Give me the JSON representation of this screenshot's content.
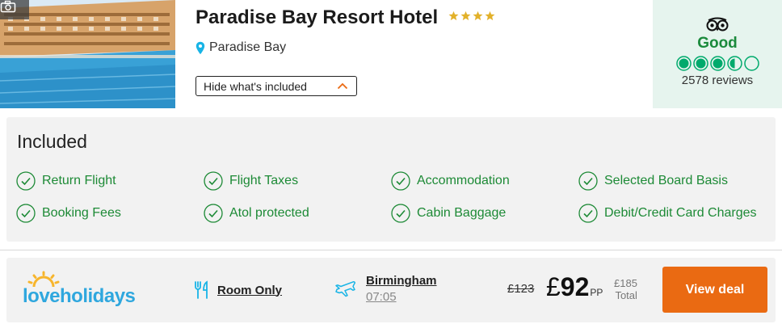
{
  "hotel": {
    "name": "Paradise Bay Resort Hotel",
    "star_rating": 4,
    "location": "Paradise Bay",
    "toggle_label": "Hide what's included",
    "photo_icon": "camera-icon"
  },
  "rating": {
    "provider_icon": "tripadvisor-owl-icon",
    "word": "Good",
    "score": 3.5,
    "max": 5,
    "reviews": "2578 reviews"
  },
  "included": {
    "title": "Included",
    "items": [
      "Return Flight",
      "Flight Taxes",
      "Accommodation",
      "Selected Board Basis",
      "Booking Fees",
      "Atol protected",
      "Cabin Baggage",
      "Debit/Credit Card Charges"
    ]
  },
  "deal": {
    "provider": "loveholidays",
    "board": "Room Only",
    "departure_airport": "Birmingham",
    "departure_time": "07:05",
    "old_price": "£123",
    "currency": "£",
    "price": "92",
    "price_suffix": "PP",
    "total_price": "£185",
    "total_label": "Total",
    "cta": "View deal"
  },
  "colors": {
    "accent_green": "#1d8a36",
    "rating_green": "#00aa6c",
    "cta_orange": "#ea6a12",
    "brand_blue": "#2fa7de"
  }
}
